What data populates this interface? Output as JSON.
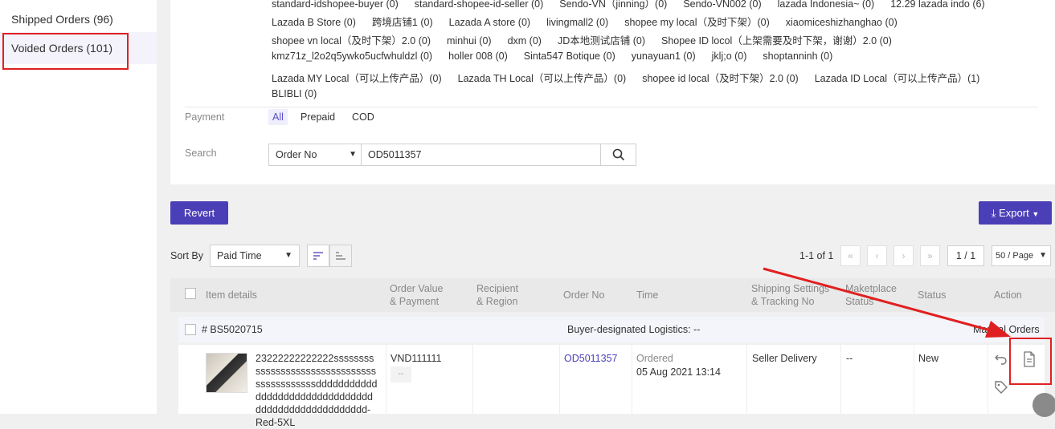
{
  "sidebar": {
    "shipped": "Shipped Orders (96)",
    "voided": "Voided Orders (101)"
  },
  "stores": {
    "row0": [
      "standard-idshopee-buyer (0)",
      "standard-shopee-id-seller (0)",
      "Sendo-VN（jinning）(0)",
      "Sendo-VN002 (0)",
      "lazada Indonesia~ (0)",
      "12.29 lazada indo (6)"
    ],
    "row1": [
      "Lazada B Store (0)",
      "跨境店铺1 (0)",
      "Lazada A store (0)",
      "livingmall2 (0)",
      "shopee my local（及时下架）(0)",
      "xiaomiceshizhanghao (0)"
    ],
    "row2": [
      "shopee vn local（及时下架）2.0 (0)",
      "minhui (0)",
      "dxm (0)",
      "JD本地测试店铺 (0)",
      "Shopee ID locol（上架需要及时下架，谢谢）2.0 (0)"
    ],
    "row3": [
      "kmz71z_l2o2q5ywko5ucfwhuldzl (0)",
      "holler 008 (0)",
      "Sinta547 Botique (0)",
      "yunayuan1 (0)",
      "jklj;o (0)",
      "shoptanninh (0)"
    ],
    "row4": [
      "Lazada MY Local（可以上传产品）(0)",
      "Lazada TH Local（可以上传产品）(0)",
      "shopee id local（及时下架）2.0 (0)",
      "Lazada ID Local（可以上传产品）(1)"
    ],
    "row5": [
      "BLIBLI (0)"
    ]
  },
  "payment": {
    "label": "Payment",
    "all": "All",
    "prepaid": "Prepaid",
    "cod": "COD"
  },
  "search": {
    "label": "Search",
    "field": "Order No",
    "value": "OD5011357"
  },
  "toolbar": {
    "revert": "Revert",
    "export": "Export"
  },
  "sort": {
    "label": "Sort By",
    "value": "Paid Time"
  },
  "pager": {
    "summary": "1-1 of 1",
    "page": "1 / 1",
    "per_page": "50 / Page"
  },
  "table": {
    "headers": {
      "item": "Item details",
      "value1": "Order Value",
      "value2": "& Payment",
      "recip1": "Recipient",
      "recip2": "& Region",
      "orderno": "Order No",
      "time": "Time",
      "ship1": "Shipping Settings",
      "ship2": "& Tracking No",
      "mkt1": "Maketplace",
      "mkt2": "Status",
      "status": "Status",
      "action": "Action"
    },
    "order": {
      "package": "# BS5020715",
      "logistics": "Buyer-designated Logistics: --",
      "manual": "Manual Orders",
      "item_text": "23222222222222ssssssssssssssssssssssssssssssssssssssssssssdddddddddddddddddddddddddddddddddddddddddddddddddddd-Red-5XL",
      "value": "VND111111",
      "value_tag": "--",
      "order_no": "OD5011357",
      "time_status": "Ordered",
      "time": "05 Aug 2021 13:14",
      "shipping": "Seller Delivery",
      "mkt_status": "--",
      "status": "New"
    }
  },
  "colors": {
    "primary": "#4b3fb7",
    "highlight": "#e02020"
  }
}
